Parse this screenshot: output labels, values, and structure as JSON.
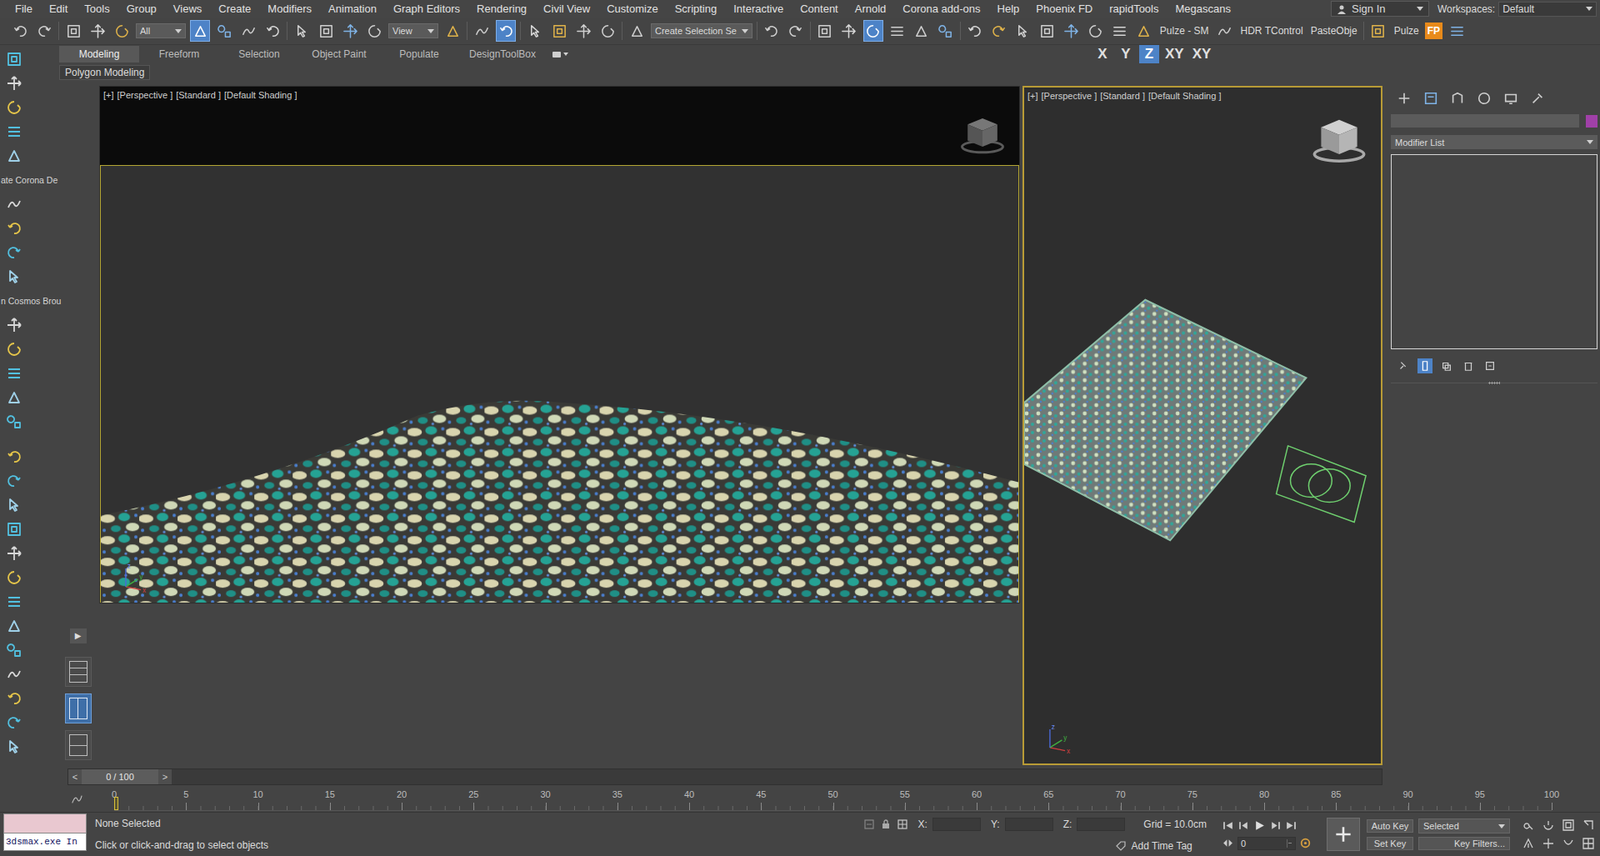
{
  "menu": [
    "File",
    "Edit",
    "Tools",
    "Group",
    "Views",
    "Create",
    "Modifiers",
    "Animation",
    "Graph Editors",
    "Rendering",
    "Civil View",
    "Customize",
    "Scripting",
    "Interactive",
    "Content",
    "Arnold",
    "Corona add-ons",
    "Help",
    "Phoenix FD",
    "rapidTools",
    "Megascans"
  ],
  "account": {
    "label": "Sign In"
  },
  "workspaces": {
    "label": "Workspaces:",
    "value": "Default"
  },
  "main_toolbar": [
    {
      "kind": "icon",
      "selected": false
    },
    {
      "kind": "icon",
      "selected": false
    },
    {
      "kind": "sep"
    },
    {
      "kind": "icon",
      "selected": false
    },
    {
      "kind": "icon",
      "selected": false
    },
    {
      "kind": "icon",
      "selected": false
    },
    {
      "kind": "dropdown",
      "text": "All"
    },
    {
      "kind": "icon",
      "selected": true
    },
    {
      "kind": "icon",
      "selected": false
    },
    {
      "kind": "icon",
      "selected": false
    },
    {
      "kind": "icon",
      "selected": false
    },
    {
      "kind": "sep"
    },
    {
      "kind": "icon",
      "selected": false
    },
    {
      "kind": "icon",
      "selected": false
    },
    {
      "kind": "icon",
      "selected": false
    },
    {
      "kind": "icon",
      "selected": false
    },
    {
      "kind": "dropdown",
      "text": "View"
    },
    {
      "kind": "icon",
      "selected": false
    },
    {
      "kind": "sep"
    },
    {
      "kind": "icon",
      "selected": false
    },
    {
      "kind": "icon",
      "selected": true
    },
    {
      "kind": "sep"
    },
    {
      "kind": "icon",
      "selected": false
    },
    {
      "kind": "icon",
      "selected": false
    },
    {
      "kind": "icon",
      "selected": false
    },
    {
      "kind": "icon",
      "selected": false
    },
    {
      "kind": "sep"
    },
    {
      "kind": "icon",
      "selected": false
    },
    {
      "kind": "dropdown",
      "text": "Create Selection Se"
    },
    {
      "kind": "sep"
    },
    {
      "kind": "icon",
      "selected": false
    },
    {
      "kind": "icon",
      "selected": false
    },
    {
      "kind": "sep"
    },
    {
      "kind": "icon",
      "selected": false
    },
    {
      "kind": "icon",
      "selected": false
    },
    {
      "kind": "icon",
      "selected": true
    },
    {
      "kind": "icon",
      "selected": false
    },
    {
      "kind": "icon",
      "selected": false
    },
    {
      "kind": "icon",
      "selected": false
    },
    {
      "kind": "sep"
    },
    {
      "kind": "icon",
      "selected": false
    },
    {
      "kind": "icon",
      "selected": false
    },
    {
      "kind": "icon",
      "selected": false
    },
    {
      "kind": "icon",
      "selected": false
    },
    {
      "kind": "icon",
      "selected": false
    },
    {
      "kind": "icon",
      "selected": false
    },
    {
      "kind": "icon",
      "selected": false
    },
    {
      "kind": "icon",
      "selected": false
    },
    {
      "kind": "label",
      "text": "Pulze - SM"
    },
    {
      "kind": "icon",
      "selected": false
    },
    {
      "kind": "label",
      "text": "HDR TControl"
    },
    {
      "kind": "label",
      "text": "PasteObje"
    },
    {
      "kind": "sep"
    },
    {
      "kind": "icon",
      "selected": false
    },
    {
      "kind": "label",
      "text": "Pulze"
    },
    {
      "kind": "badge",
      "text": "FP"
    },
    {
      "kind": "icon",
      "selected": false
    }
  ],
  "ribbon": {
    "tabs": [
      {
        "label": "Modeling",
        "selected": true
      },
      {
        "label": "Freeform",
        "selected": false
      },
      {
        "label": "Selection",
        "selected": false
      },
      {
        "label": "Object Paint",
        "selected": false
      },
      {
        "label": "Populate",
        "selected": false
      },
      {
        "label": "DesignToolBox",
        "selected": false
      }
    ],
    "panel": "Polygon Modeling"
  },
  "axis_constraints": [
    {
      "label": "X",
      "selected": false
    },
    {
      "label": "Y",
      "selected": false
    },
    {
      "label": "Z",
      "selected": true
    },
    {
      "label": "XY",
      "selected": false
    },
    {
      "label": "XY",
      "selected": false
    }
  ],
  "command_toolbar": {
    "labels": [
      "ate Corona De",
      "n Cosmos Brou"
    ]
  },
  "layout_tabs": {
    "expand": "▶",
    "tabs": [
      {
        "selected": false
      },
      {
        "selected": true
      },
      {
        "selected": false
      }
    ]
  },
  "viewports": [
    {
      "kind": "safe-frame",
      "active": false,
      "labels": [
        "[+]",
        "[Perspective ]",
        "[Standard ]",
        "[Default Shading ]"
      ],
      "axes": [
        "x",
        "y",
        "z"
      ]
    },
    {
      "kind": "plain",
      "active": true,
      "labels": [
        "[+]",
        "[Perspective ]",
        "[Standard ]",
        "[Default Shading ]"
      ],
      "axes": [
        "x",
        "y",
        "z"
      ]
    }
  ],
  "command_panel": {
    "tabs": [
      {
        "selected": false
      },
      {
        "selected": true
      },
      {
        "selected": false
      },
      {
        "selected": false
      },
      {
        "selected": false
      },
      {
        "selected": false
      }
    ],
    "name": "",
    "modifier_list": "Modifier List",
    "stack_buttons": [
      {
        "selected": false
      },
      {
        "selected": true
      },
      {
        "selected": false
      },
      {
        "selected": false
      },
      {
        "selected": false
      }
    ]
  },
  "time_slider": {
    "prev": "<",
    "position": "0 / 100",
    "next": ">",
    "level": 0
  },
  "track_bar": {
    "ticks": [
      "0",
      "5",
      "10",
      "15",
      "20",
      "25",
      "30",
      "35",
      "40",
      "45",
      "50",
      "55",
      "60",
      "65",
      "70",
      "75",
      "80",
      "85",
      "90",
      "95",
      "100"
    ],
    "level": 0
  },
  "status_bar": {
    "listener": "3dsmax.exe In",
    "selection": "None Selected",
    "prompt": "Click or click-and-drag to select objects",
    "coords": [
      {
        "axis": "X:",
        "value": ""
      },
      {
        "axis": "Y:",
        "value": ""
      },
      {
        "axis": "Z:",
        "value": ""
      }
    ],
    "grid": "Grid = 10.0cm",
    "time_tag": "Add Time Tag",
    "auto_key": {
      "label": "Auto Key",
      "on": false
    },
    "key_mode": "Selected",
    "set_key": "Set Key",
    "key_filters": "Key Filters...",
    "frame": "0"
  }
}
